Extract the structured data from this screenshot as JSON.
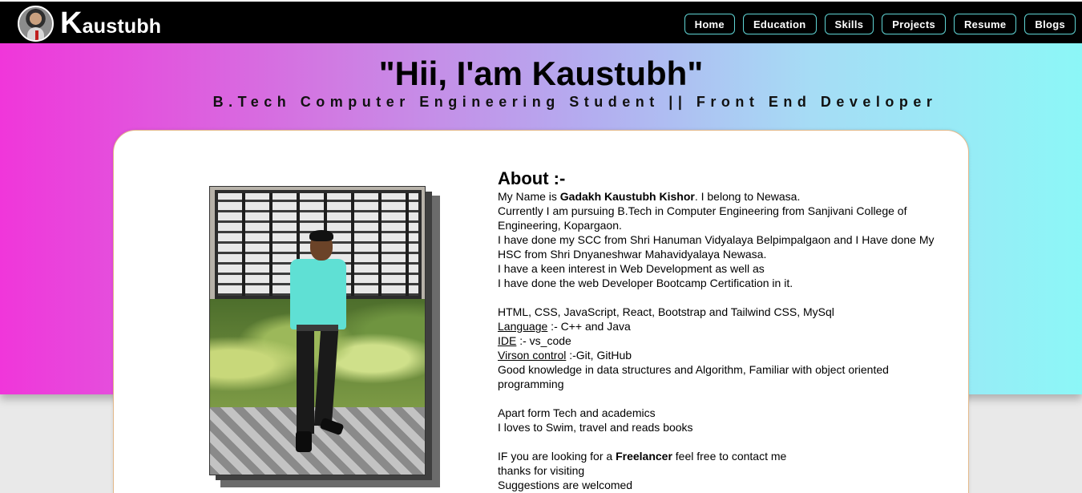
{
  "brand": {
    "initial": "K",
    "rest": "austubh"
  },
  "nav": [
    "Home",
    "Education",
    "Skills",
    "Projects",
    "Resume",
    "Blogs"
  ],
  "hero": {
    "title": "\"Hii, I'am Kaustubh\"",
    "subtitle": "B.Tech Computer Engineering Student || Front End Developer"
  },
  "about": {
    "heading": "About :-",
    "intro_prefix": "My Name is ",
    "name_bold": "Gadakh Kaustubh Kishor",
    "intro_suffix": ". I belong to Newasa.",
    "pursuing": "Currently I am pursuing B.Tech in Computer Engineering from Sanjivani College of Engineering, Kopargaon.",
    "schooling": "I have done my SCC from Shri Hanuman Vidyalaya Belpimpalgaon and I Have done My HSC from Shri Dnyaneshwar Mahavidyalaya Newasa.",
    "interest": "I have a keen interest in Web Development as well as",
    "bootcamp": "I have done the web Developer Bootcamp Certification in it.",
    "skills": "HTML, CSS, JavaScript, React, Bootstrap and Tailwind CSS, MySql",
    "language_label": "Language",
    "language_value": " :- C++ and Java",
    "ide_label": "IDE",
    "ide_value": " :- vs_code",
    "vc_label": "Virson control",
    "vc_value": " :-Git, GitHub",
    "knowledge": "Good knowledge in data structures and Algorithm, Familiar with object oriented programming",
    "apart": "Apart form Tech and academics",
    "hobbies": "I loves to Swim, travel and reads books",
    "freelance_prefix": "IF you are looking for a ",
    "freelance_bold": "Freelancer",
    "freelance_suffix": " feel free to contact me",
    "thanks": "thanks for visiting",
    "suggestions": "Suggestions are welcomed"
  }
}
